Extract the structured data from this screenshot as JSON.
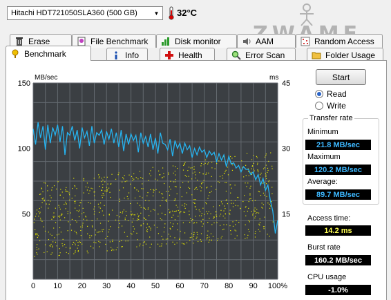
{
  "drive": {
    "name": "Hitachi HDT721050SLA360 (500 GB)"
  },
  "temperature": "32°C",
  "watermark": "ZWAME",
  "tabs_row1": [
    {
      "label": "Erase",
      "icon": "trash-icon"
    },
    {
      "label": "File Benchmark",
      "icon": "file-benchmark-icon"
    },
    {
      "label": "Disk monitor",
      "icon": "disk-monitor-icon"
    },
    {
      "label": "AAM",
      "icon": "speaker-icon"
    },
    {
      "label": "Random Access",
      "icon": "random-access-icon"
    }
  ],
  "tabs_row2": [
    {
      "label": "Benchmark",
      "icon": "benchmark-icon",
      "active": true
    },
    {
      "label": "Info",
      "icon": "info-icon"
    },
    {
      "label": "Health",
      "icon": "health-icon"
    },
    {
      "label": "Error Scan",
      "icon": "magnifier-icon"
    },
    {
      "label": "Folder Usage",
      "icon": "folder-icon"
    }
  ],
  "controls": {
    "start_label": "Start",
    "read_label": "Read",
    "write_label": "Write",
    "mode": "Read"
  },
  "stats": {
    "transfer_title": "Transfer rate",
    "minimum_label": "Minimum",
    "minimum_value": "21.8 MB/sec",
    "maximum_label": "Maximum",
    "maximum_value": "120.2 MB/sec",
    "average_label": "Average:",
    "average_value": "89.7 MB/sec",
    "access_label": "Access time:",
    "access_value": "14.2 ms",
    "burst_label": "Burst rate",
    "burst_value": "160.2 MB/sec",
    "cpu_label": "CPU usage",
    "cpu_value": "-1.0%"
  },
  "colors": {
    "transfer_line": "#26b4f0",
    "access_dots": "#e6e600",
    "plot_bg": "#3b3f43",
    "grid": "#646a70"
  },
  "chart_data": {
    "type": "line",
    "left_axis_label": "MB/sec",
    "right_axis_label": "ms",
    "left_ticks": [
      150,
      100,
      50
    ],
    "right_ticks": [
      45,
      30,
      15
    ],
    "x_ticks": [
      "0",
      "10",
      "20",
      "30",
      "40",
      "50",
      "60",
      "70",
      "80",
      "90",
      "100%"
    ],
    "xlim": [
      0,
      100
    ],
    "ylim_left": [
      0,
      150
    ],
    "ylim_right": [
      0,
      45
    ],
    "grid": true,
    "series": [
      {
        "name": "Transfer rate",
        "axis": "left",
        "x": [
          0,
          1,
          2,
          3,
          4,
          5,
          6,
          7,
          8,
          9,
          10,
          11,
          12,
          13,
          14,
          15,
          16,
          17,
          18,
          19,
          20,
          21,
          22,
          23,
          24,
          25,
          26,
          27,
          28,
          29,
          30,
          31,
          32,
          33,
          34,
          35,
          36,
          37,
          38,
          39,
          40,
          41,
          42,
          43,
          44,
          45,
          46,
          47,
          48,
          49,
          50,
          51,
          52,
          53,
          54,
          55,
          56,
          57,
          58,
          59,
          60,
          61,
          62,
          63,
          64,
          65,
          66,
          67,
          68,
          69,
          70,
          71,
          72,
          73,
          74,
          75,
          76,
          77,
          78,
          79,
          80,
          81,
          82,
          83,
          84,
          85,
          86,
          87,
          88,
          89,
          90,
          91,
          92,
          93,
          94,
          95,
          96,
          97,
          98,
          99,
          100
        ],
        "y": [
          115,
          103,
          120,
          108,
          117,
          99,
          118,
          104,
          116,
          110,
          118,
          105,
          117,
          95,
          112,
          110,
          117,
          106,
          114,
          100,
          116,
          108,
          113,
          102,
          117,
          104,
          112,
          110,
          114,
          103,
          113,
          107,
          115,
          104,
          112,
          101,
          114,
          98,
          111,
          103,
          111,
          106,
          110,
          97,
          112,
          104,
          109,
          101,
          111,
          99,
          108,
          96,
          112,
          104,
          103,
          99,
          107,
          94,
          106,
          100,
          104,
          96,
          104,
          99,
          102,
          93,
          100,
          95,
          101,
          97,
          99,
          93,
          98,
          95,
          97,
          90,
          96,
          91,
          95,
          86,
          94,
          88,
          89,
          85,
          87,
          82,
          86,
          84,
          84,
          80,
          82,
          76,
          80,
          72,
          77,
          68,
          72,
          60,
          52,
          35,
          45
        ]
      },
      {
        "name": "Access time",
        "axis": "right",
        "style": "scatter",
        "spread_ms": [
          5,
          22
        ],
        "mean_ms": 14.2
      }
    ]
  }
}
